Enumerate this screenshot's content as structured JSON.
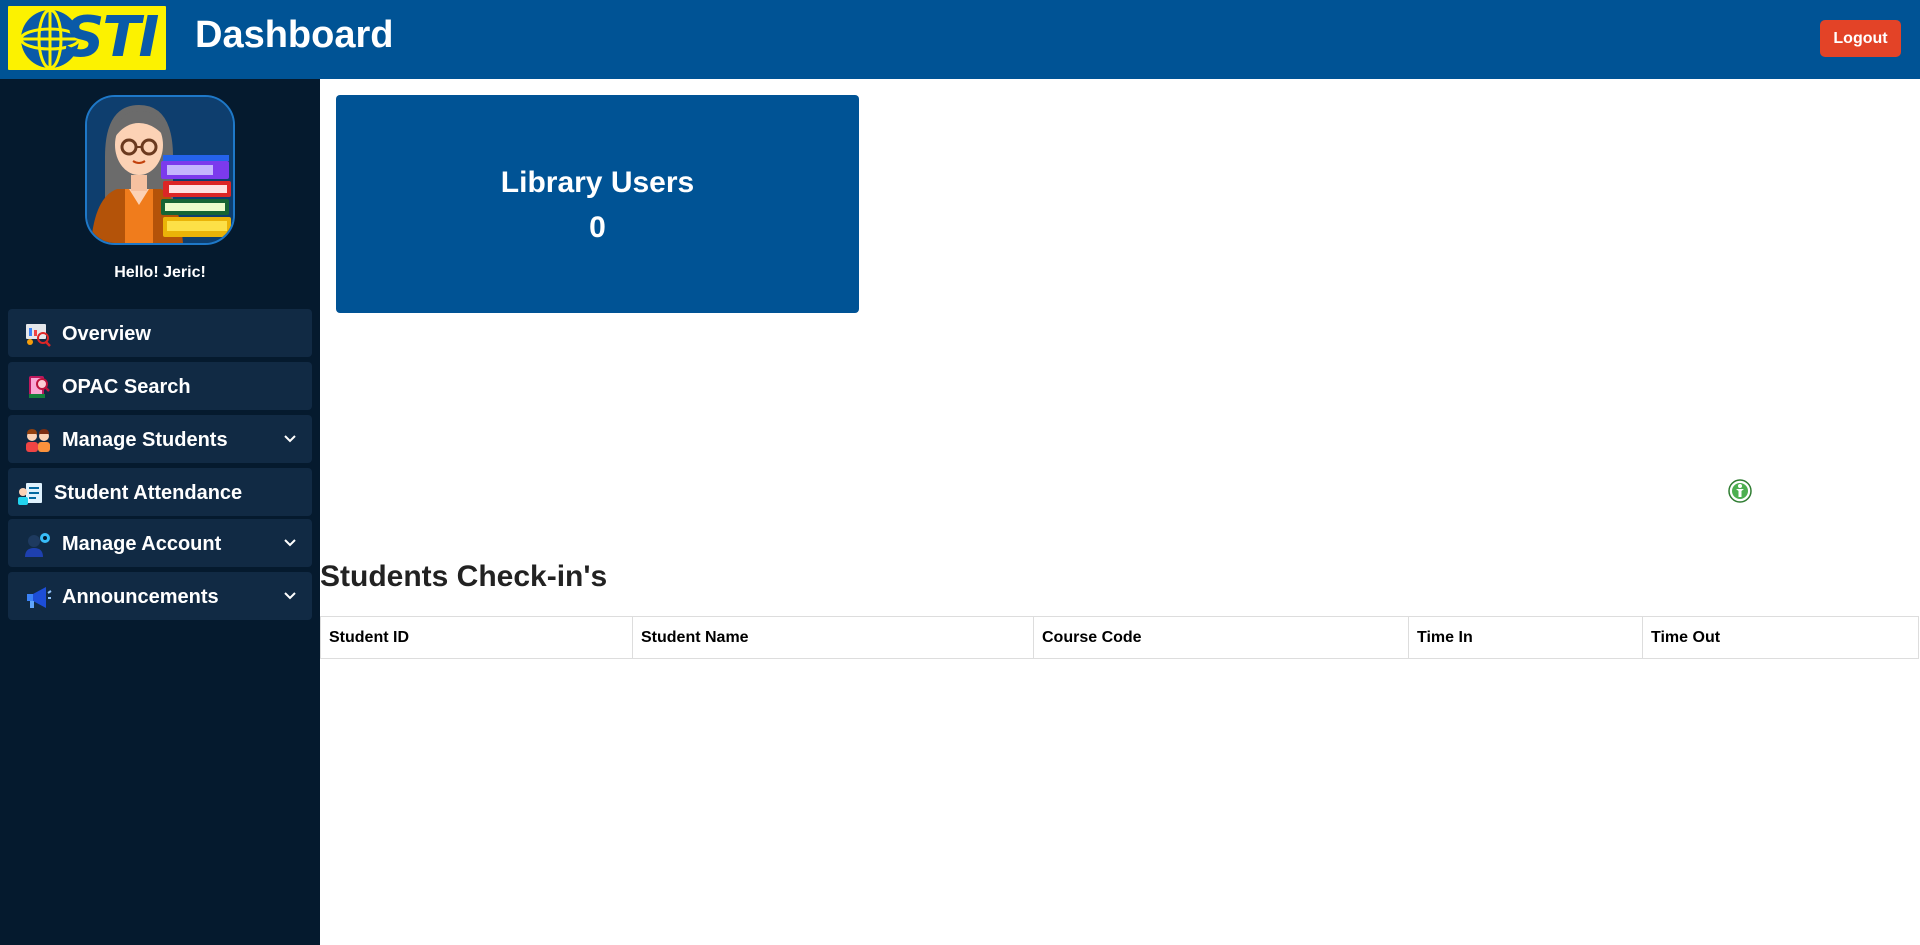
{
  "header": {
    "logo_text": "STI",
    "title": "Dashboard",
    "logout_label": "Logout"
  },
  "sidebar": {
    "greeting": "Hello! Jeric!",
    "items": [
      {
        "label": "Overview",
        "icon": "presentation-search-icon",
        "has_dropdown": false
      },
      {
        "label": "OPAC Search",
        "icon": "book-search-icon",
        "has_dropdown": false
      },
      {
        "label": "Manage Students",
        "icon": "students-icon",
        "has_dropdown": true
      },
      {
        "label": "Student Attendance",
        "icon": "attendance-icon",
        "has_dropdown": false
      },
      {
        "label": "Manage Account",
        "icon": "user-settings-icon",
        "has_dropdown": true
      },
      {
        "label": "Announcements",
        "icon": "megaphone-icon",
        "has_dropdown": true
      }
    ]
  },
  "stats": {
    "library_users_label": "Library Users",
    "library_users_value": "0"
  },
  "checkins": {
    "title": "Students Check-in's",
    "columns": [
      "Student ID",
      "Student Name",
      "Course Code",
      "Time In",
      "Time Out"
    ],
    "rows": []
  },
  "colors": {
    "primary": "#005395",
    "sidebar": "#051a2e",
    "nav_item": "#112a44",
    "logout": "#e34327",
    "logo_bg": "#fcf200"
  }
}
